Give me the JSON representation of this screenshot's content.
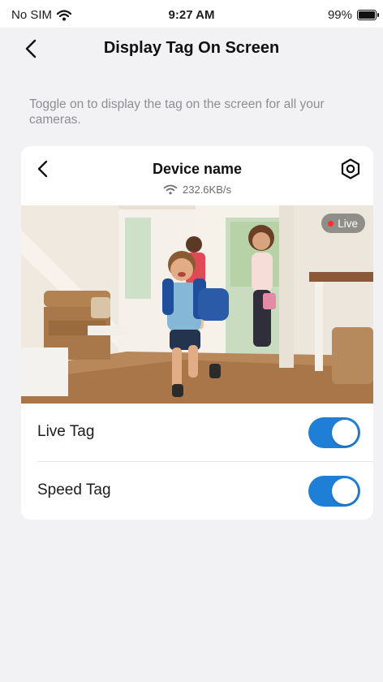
{
  "status_bar": {
    "carrier": "No SIM",
    "time": "9:27 AM",
    "battery": "99%",
    "battery_level": 0.99
  },
  "nav": {
    "title": "Display Tag On Screen"
  },
  "hint": "Toggle on to display the tag on the screen for all your cameras.",
  "card": {
    "device_name": "Device name",
    "speed": "232.6KB/s",
    "live_badge": "Live",
    "rows": [
      {
        "label": "Live Tag",
        "enabled": true
      },
      {
        "label": "Speed Tag",
        "enabled": true
      }
    ]
  },
  "colors": {
    "accent": "#1f7fd6",
    "background": "#f2f2f4",
    "live_dot": "#ff2d2d"
  },
  "icons": [
    "wifi-icon",
    "battery-icon",
    "back-chevron-icon",
    "settings-hexagon-icon",
    "wifi-signal-icon"
  ]
}
